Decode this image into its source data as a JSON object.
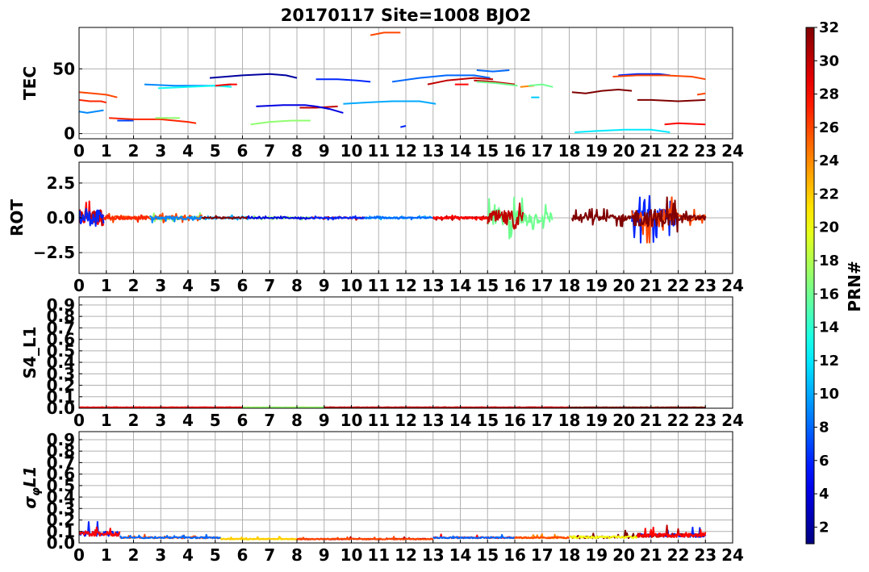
{
  "title": "20170117 Site=1008 BJO2",
  "colorbar": {
    "label": "PRN#",
    "ticks": [
      "2",
      "4",
      "6",
      "8",
      "10",
      "12",
      "14",
      "16",
      "18",
      "20",
      "22",
      "24",
      "26",
      "28",
      "30",
      "32"
    ],
    "colormap": "jet",
    "range": [
      1,
      32
    ]
  },
  "chart_data": [
    {
      "type": "line",
      "ylabel": "TEC",
      "xlim": [
        0,
        24
      ],
      "ylim": [
        -4,
        82
      ],
      "xticks": [
        "0",
        "1",
        "2",
        "3",
        "4",
        "5",
        "6",
        "7",
        "8",
        "9",
        "10",
        "11",
        "12",
        "13",
        "14",
        "15",
        "16",
        "17",
        "18",
        "19",
        "20",
        "21",
        "22",
        "23",
        "24"
      ],
      "yticks": [
        {
          "v": 0,
          "label": "0"
        },
        {
          "v": 50,
          "label": "50"
        }
      ],
      "grid": true,
      "series": [
        {
          "prn": 9,
          "x": [
            0.0,
            0.3,
            0.6,
            0.9
          ],
          "y": [
            17,
            16,
            17,
            18
          ]
        },
        {
          "prn": 27,
          "x": [
            0.0,
            0.4,
            0.8,
            1.0
          ],
          "y": [
            26,
            25,
            25,
            24
          ]
        },
        {
          "prn": 26,
          "x": [
            0.0,
            0.5,
            1.0,
            1.4
          ],
          "y": [
            32,
            31,
            30,
            28
          ]
        },
        {
          "prn": 7,
          "x": [
            1.4,
            1.7,
            2.0
          ],
          "y": [
            10,
            10,
            10
          ]
        },
        {
          "prn": 27,
          "x": [
            1.1,
            2.0,
            3.0,
            4.0,
            4.3
          ],
          "y": [
            12,
            11,
            11,
            9,
            8
          ]
        },
        {
          "prn": 17,
          "x": [
            2.8,
            3.2,
            3.7
          ],
          "y": [
            12,
            12,
            12
          ]
        },
        {
          "prn": 9,
          "x": [
            2.4,
            3.5,
            4.5,
            5.3,
            5.6
          ],
          "y": [
            38,
            37,
            37,
            37,
            38
          ]
        },
        {
          "prn": 13,
          "x": [
            2.9,
            4.0,
            5.0,
            5.6
          ],
          "y": [
            35,
            36,
            37,
            36
          ]
        },
        {
          "prn": 28,
          "x": [
            5.0,
            5.5,
            5.8
          ],
          "y": [
            37,
            38,
            38
          ]
        },
        {
          "prn": 2,
          "x": [
            4.8,
            6.0,
            7.0,
            7.6,
            8.0
          ],
          "y": [
            43,
            45,
            46,
            45,
            43
          ]
        },
        {
          "prn": 4,
          "x": [
            6.5,
            7.5,
            8.3,
            8.7
          ],
          "y": [
            21,
            22,
            22,
            21
          ]
        },
        {
          "prn": 30,
          "x": [
            8.1,
            8.7,
            9.5
          ],
          "y": [
            20,
            20,
            21
          ]
        },
        {
          "prn": 4,
          "x": [
            8.7,
            9.2,
            9.7
          ],
          "y": [
            21,
            19,
            16
          ]
        },
        {
          "prn": 17,
          "x": [
            6.3,
            7.0,
            7.8,
            8.5
          ],
          "y": [
            7,
            9,
            10,
            10
          ]
        },
        {
          "prn": 6,
          "x": [
            8.7,
            9.5,
            10.2,
            10.7
          ],
          "y": [
            42,
            42,
            41,
            40
          ]
        },
        {
          "prn": 10,
          "x": [
            9.7,
            10.5,
            11.5,
            12.5,
            13.1
          ],
          "y": [
            23,
            24,
            25,
            25,
            23
          ]
        },
        {
          "prn": 26,
          "x": [
            10.7,
            11.2,
            11.8
          ],
          "y": [
            76,
            78,
            78
          ]
        },
        {
          "prn": 6,
          "x": [
            11.8,
            12.0
          ],
          "y": [
            5,
            6
          ]
        },
        {
          "prn": 8,
          "x": [
            11.5,
            12.5,
            13.5,
            14.5,
            15.1
          ],
          "y": [
            40,
            43,
            45,
            45,
            43
          ]
        },
        {
          "prn": 30,
          "x": [
            12.8,
            13.5,
            14.5,
            15.2
          ],
          "y": [
            38,
            41,
            43,
            42
          ]
        },
        {
          "prn": 28,
          "x": [
            13.8,
            14.3
          ],
          "y": [
            38,
            38
          ]
        },
        {
          "prn": 30,
          "x": [
            14.5,
            15.2,
            16.0
          ],
          "y": [
            41,
            40,
            38
          ]
        },
        {
          "prn": 8,
          "x": [
            14.6,
            15.2,
            15.8
          ],
          "y": [
            49,
            48,
            49
          ]
        },
        {
          "prn": 16,
          "x": [
            14.6,
            15.3,
            16.1
          ],
          "y": [
            40,
            39,
            37
          ]
        },
        {
          "prn": 24,
          "x": [
            16.2,
            16.7
          ],
          "y": [
            36,
            37
          ]
        },
        {
          "prn": 16,
          "x": [
            16.5,
            17.0,
            17.4
          ],
          "y": [
            37,
            38,
            36
          ]
        },
        {
          "prn": 11,
          "x": [
            16.6,
            16.9
          ],
          "y": [
            28,
            28
          ]
        },
        {
          "prn": 32,
          "x": [
            18.1,
            18.6,
            19.2,
            19.8,
            20.3
          ],
          "y": [
            32,
            31,
            33,
            34,
            33
          ]
        },
        {
          "prn": 12,
          "x": [
            18.2,
            19.0,
            20.0,
            21.0,
            21.7
          ],
          "y": [
            1,
            2,
            3,
            3,
            1
          ]
        },
        {
          "prn": 6,
          "x": [
            19.8,
            20.5,
            21.3,
            21.7
          ],
          "y": [
            45,
            46,
            46,
            45
          ]
        },
        {
          "prn": 26,
          "x": [
            19.6,
            20.5,
            21.5,
            22.5,
            23.0
          ],
          "y": [
            44,
            45,
            45,
            44,
            42
          ]
        },
        {
          "prn": 32,
          "x": [
            20.5,
            21.0,
            22.0,
            23.0
          ],
          "y": [
            26,
            26,
            25,
            26
          ]
        },
        {
          "prn": 28,
          "x": [
            21.5,
            22.0,
            23.0
          ],
          "y": [
            7,
            8,
            7
          ]
        },
        {
          "prn": 26,
          "x": [
            22.7,
            23.0
          ],
          "y": [
            30,
            31
          ]
        }
      ]
    },
    {
      "type": "line",
      "ylabel": "ROT",
      "xlim": [
        0,
        24
      ],
      "ylim": [
        -4,
        4
      ],
      "xticks": [
        "0",
        "1",
        "2",
        "3",
        "4",
        "5",
        "6",
        "7",
        "8",
        "9",
        "10",
        "11",
        "12",
        "13",
        "14",
        "15",
        "16",
        "17",
        "18",
        "19",
        "20",
        "21",
        "22",
        "23",
        "24"
      ],
      "yticks": [
        {
          "v": -2.5,
          "label": "−2.5"
        },
        {
          "v": 0,
          "label": "0.0"
        },
        {
          "v": 2.5,
          "label": "2.5"
        }
      ],
      "grid": true,
      "segments": [
        {
          "start": 0.0,
          "end": 0.9,
          "amp": 1.6,
          "prns": [
            28,
            30,
            6
          ]
        },
        {
          "start": 0.9,
          "end": 2.6,
          "amp": 0.35,
          "prns": [
            26,
            27
          ]
        },
        {
          "start": 2.6,
          "end": 4.5,
          "amp": 0.35,
          "prns": [
            17,
            26,
            9
          ]
        },
        {
          "start": 4.5,
          "end": 6.2,
          "amp": 0.2,
          "prns": [
            10,
            32
          ]
        },
        {
          "start": 6.2,
          "end": 8.5,
          "amp": 0.15,
          "prns": [
            17,
            4
          ]
        },
        {
          "start": 8.5,
          "end": 10.5,
          "amp": 0.15,
          "prns": [
            30,
            6
          ]
        },
        {
          "start": 10.5,
          "end": 13.0,
          "amp": 0.15,
          "prns": [
            10,
            8
          ]
        },
        {
          "start": 13.0,
          "end": 15.0,
          "amp": 0.2,
          "prns": [
            30,
            28
          ]
        },
        {
          "start": 15.0,
          "end": 16.3,
          "amp": 1.5,
          "prns": [
            16,
            30
          ]
        },
        {
          "start": 16.3,
          "end": 17.4,
          "amp": 1.2,
          "prns": [
            16
          ]
        },
        {
          "start": 18.1,
          "end": 20.3,
          "amp": 0.7,
          "prns": [
            32
          ]
        },
        {
          "start": 20.3,
          "end": 22.0,
          "amp": 1.8,
          "prns": [
            6,
            26,
            32
          ]
        },
        {
          "start": 22.0,
          "end": 23.0,
          "amp": 0.6,
          "prns": [
            26,
            32
          ]
        }
      ]
    },
    {
      "type": "line",
      "ylabel": "S4_L1",
      "xlim": [
        0,
        24
      ],
      "ylim": [
        0,
        0.97
      ],
      "xticks": [
        "0",
        "1",
        "2",
        "3",
        "4",
        "5",
        "6",
        "7",
        "8",
        "9",
        "10",
        "11",
        "12",
        "13",
        "14",
        "15",
        "16",
        "17",
        "18",
        "19",
        "20",
        "21",
        "22",
        "23",
        "24"
      ],
      "yticks": [
        {
          "v": 0.0,
          "label": "0.0"
        },
        {
          "v": 0.1,
          "label": "0.1"
        },
        {
          "v": 0.2,
          "label": "0.2"
        },
        {
          "v": 0.3,
          "label": "0.3"
        },
        {
          "v": 0.4,
          "label": "0.4"
        },
        {
          "v": 0.5,
          "label": "0.5"
        },
        {
          "v": 0.6,
          "label": "0.6"
        },
        {
          "v": 0.7,
          "label": "0.7"
        },
        {
          "v": 0.8,
          "label": "0.8"
        },
        {
          "v": 0.9,
          "label": "0.9"
        }
      ],
      "grid": true,
      "baseline": 0.005,
      "segments": [
        {
          "start": 0.0,
          "end": 6.0,
          "prns": [
            30,
            28
          ]
        },
        {
          "start": 6.0,
          "end": 9.0,
          "prns": [
            20,
            17
          ]
        },
        {
          "start": 9.0,
          "end": 18.0,
          "prns": [
            28,
            30
          ]
        },
        {
          "start": 18.0,
          "end": 23.0,
          "prns": [
            18,
            32
          ]
        }
      ]
    },
    {
      "type": "line",
      "ylabel": "σφL1",
      "xlim": [
        0,
        24
      ],
      "ylim": [
        0,
        0.97
      ],
      "xticks": [
        "0",
        "1",
        "2",
        "3",
        "4",
        "5",
        "6",
        "7",
        "8",
        "9",
        "10",
        "11",
        "12",
        "13",
        "14",
        "15",
        "16",
        "17",
        "18",
        "19",
        "20",
        "21",
        "22",
        "23",
        "24"
      ],
      "yticks": [
        {
          "v": 0.0,
          "label": "0.0"
        },
        {
          "v": 0.1,
          "label": "0.1"
        },
        {
          "v": 0.2,
          "label": "0.2"
        },
        {
          "v": 0.3,
          "label": "0.3"
        },
        {
          "v": 0.4,
          "label": "0.4"
        },
        {
          "v": 0.5,
          "label": "0.5"
        },
        {
          "v": 0.6,
          "label": "0.6"
        },
        {
          "v": 0.7,
          "label": "0.7"
        },
        {
          "v": 0.8,
          "label": "0.8"
        },
        {
          "v": 0.9,
          "label": "0.9"
        }
      ],
      "grid": true,
      "segments": [
        {
          "start": 0.0,
          "end": 1.5,
          "base": 0.06,
          "amp": 0.1,
          "prns": [
            6,
            28
          ]
        },
        {
          "start": 1.5,
          "end": 5.2,
          "base": 0.04,
          "amp": 0.03,
          "prns": [
            26,
            8
          ]
        },
        {
          "start": 5.2,
          "end": 8.0,
          "base": 0.03,
          "amp": 0.02,
          "prns": [
            20,
            22
          ]
        },
        {
          "start": 8.0,
          "end": 13.0,
          "base": 0.03,
          "amp": 0.02,
          "prns": [
            30,
            26
          ]
        },
        {
          "start": 13.0,
          "end": 16.0,
          "base": 0.04,
          "amp": 0.03,
          "prns": [
            28,
            8
          ]
        },
        {
          "start": 16.0,
          "end": 18.0,
          "base": 0.04,
          "amp": 0.03,
          "prns": [
            24,
            26
          ]
        },
        {
          "start": 18.0,
          "end": 20.5,
          "base": 0.04,
          "amp": 0.05,
          "prns": [
            32,
            20
          ]
        },
        {
          "start": 20.5,
          "end": 23.0,
          "base": 0.05,
          "amp": 0.08,
          "prns": [
            6,
            30,
            28
          ]
        }
      ]
    }
  ]
}
